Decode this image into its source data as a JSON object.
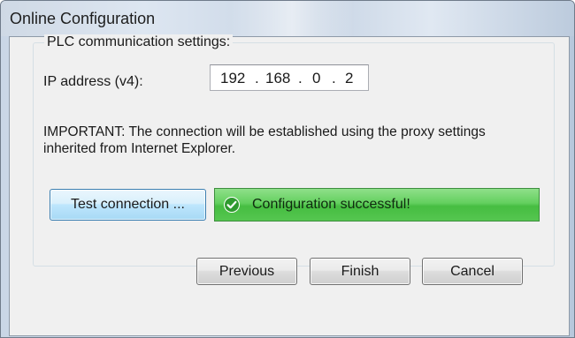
{
  "window": {
    "title": "Online Configuration"
  },
  "group": {
    "legend": "PLC communication settings:"
  },
  "ip": {
    "label": "IP address (v4):",
    "octets": [
      "192",
      "168",
      "0",
      "2"
    ],
    "separator": "."
  },
  "notice": "IMPORTANT: The connection will be established using the proxy settings inherited from Internet Explorer.",
  "test_button": {
    "label": "Test connection ..."
  },
  "status": {
    "text": "Configuration successful!",
    "icon": "check-circle-icon",
    "color": "#46bd41"
  },
  "buttons": {
    "previous": "Previous",
    "finish": "Finish",
    "cancel": "Cancel"
  }
}
